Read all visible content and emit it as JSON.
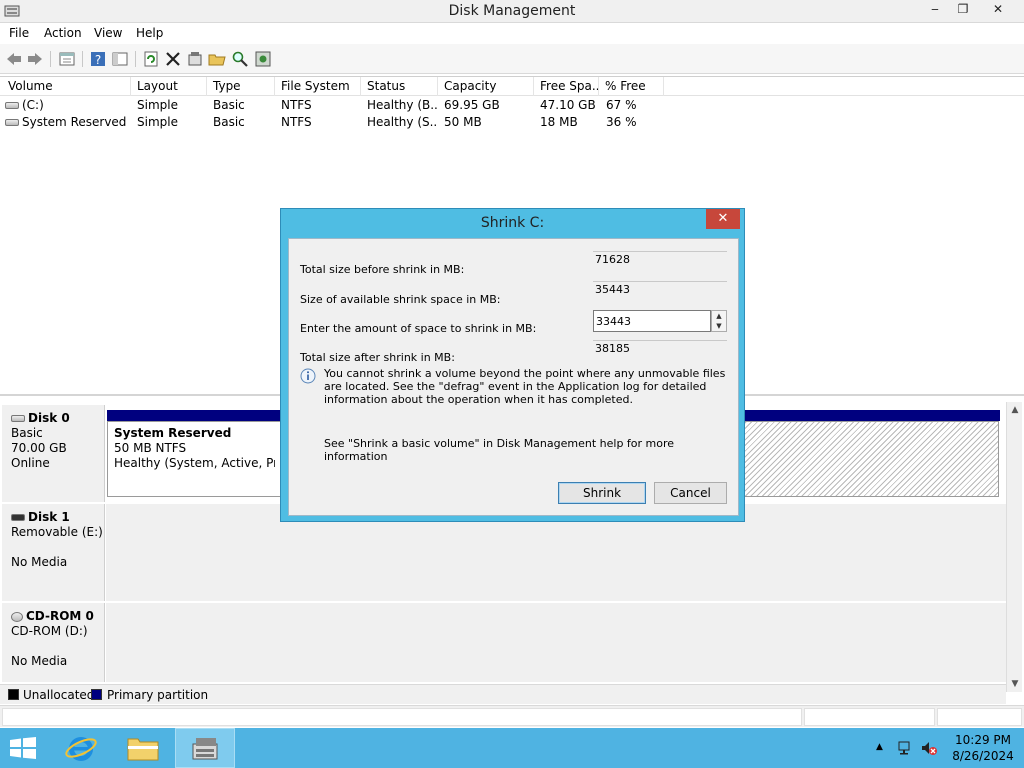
{
  "window": {
    "title": "Disk Management"
  },
  "menu": [
    "File",
    "Action",
    "View",
    "Help"
  ],
  "volume_list": {
    "columns": [
      "Volume",
      "Layout",
      "Type",
      "File System",
      "Status",
      "Capacity",
      "Free Spa...",
      "% Free"
    ],
    "rows": [
      [
        "(C:)",
        "Simple",
        "Basic",
        "NTFS",
        "Healthy (B...",
        "69.95 GB",
        "47.10 GB",
        "67 %"
      ],
      [
        "System Reserved",
        "Simple",
        "Basic",
        "NTFS",
        "Healthy (S...",
        "50 MB",
        "18 MB",
        "36 %"
      ]
    ]
  },
  "disks": [
    {
      "name": "Disk 0",
      "lines": [
        "Basic",
        "70.00 GB",
        "Online"
      ]
    },
    {
      "name": "Disk 1",
      "lines": [
        "Removable (E:)",
        "",
        "No Media"
      ]
    },
    {
      "name": "CD-ROM 0",
      "lines": [
        "CD-ROM (D:)",
        "",
        "No Media"
      ]
    }
  ],
  "partition": {
    "title": "System Reserved",
    "size": "50 MB NTFS",
    "status": "Healthy (System, Active, Primar"
  },
  "legend": [
    {
      "label": "Unallocated",
      "color": "#000000"
    },
    {
      "label": "Primary partition",
      "color": "#00007f"
    }
  ],
  "dialog": {
    "title": "Shrink C:",
    "close": "✕",
    "fields": [
      {
        "label": "Total size before shrink in MB:",
        "value": "71628"
      },
      {
        "label": "Size of available shrink space in MB:",
        "value": "35443"
      },
      {
        "label": "Enter the amount of space to shrink in MB:",
        "value": "33443"
      },
      {
        "label": "Total size after shrink in MB:",
        "value": "38185"
      }
    ],
    "info": "You cannot shrink a volume beyond the point where any unmovable files are located. See the \"defrag\" event in the Application log for detailed information about the operation when it has completed.",
    "help": "See \"Shrink a basic volume\" in Disk Management help for more information",
    "shrink_label": "Shrink",
    "cancel_label": "Cancel"
  },
  "taskbar": {
    "time": "10:29 PM",
    "date": "8/26/2024"
  },
  "colors": {
    "accent": "#4fbde3",
    "taskbar": "#4fb3e2",
    "primary_partition": "#00007f"
  },
  "icons": [
    "back-icon",
    "forward-icon",
    "properties-icon",
    "help-icon",
    "console-icon",
    "refresh-icon",
    "delete-icon",
    "settings-icon",
    "open-folder-icon",
    "search-icon",
    "rescan-icon"
  ]
}
